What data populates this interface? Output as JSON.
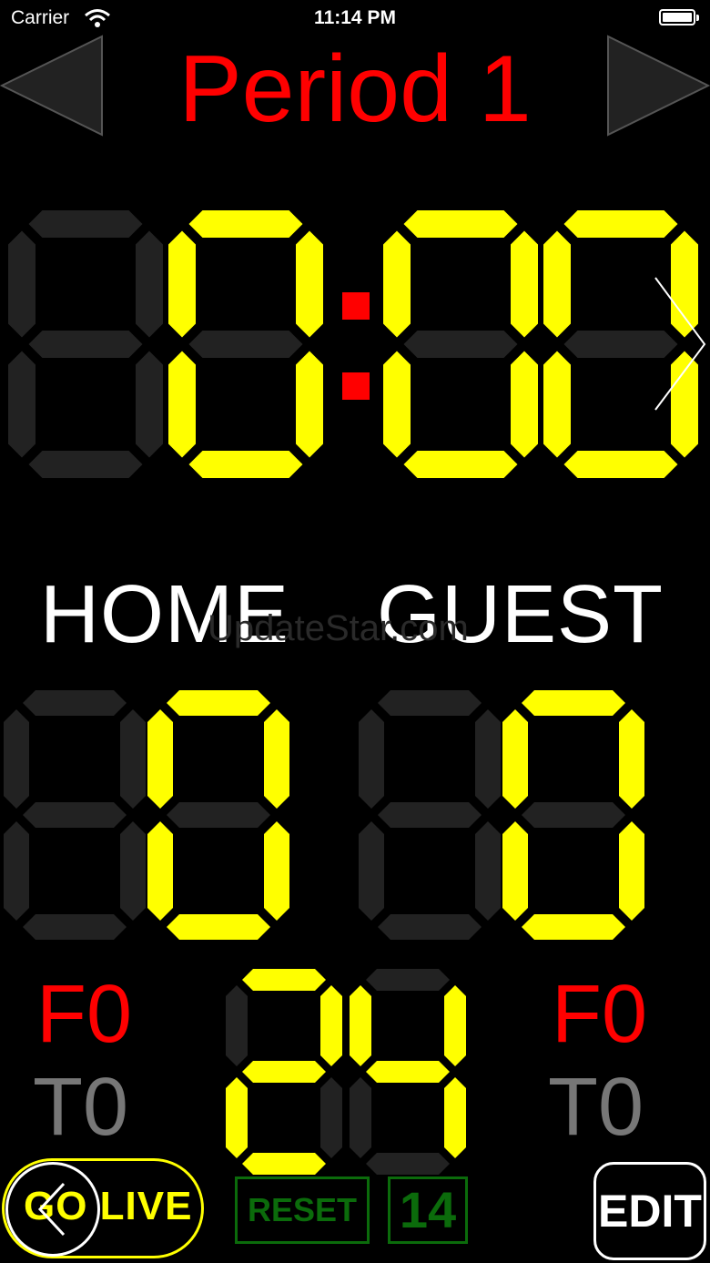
{
  "status_bar": {
    "carrier": "Carrier",
    "time": "11:14 PM",
    "wifi_icon": "wifi-icon",
    "battery_icon": "battery-icon"
  },
  "period": {
    "label": "Period 1"
  },
  "game_clock": {
    "digits": [
      " ",
      "0",
      "0",
      "0"
    ],
    "separator": ":"
  },
  "teams": {
    "home": {
      "label": "HOME",
      "score_digits": [
        " ",
        "0"
      ],
      "fouls": "F0",
      "timeouts": "T0"
    },
    "guest": {
      "label": "GUEST",
      "score_digits": [
        " ",
        "0"
      ],
      "fouls": "F0",
      "timeouts": "T0"
    }
  },
  "shot_clock": {
    "digits": [
      "2",
      "4"
    ]
  },
  "watermark": "UpdateStar.com",
  "controls": {
    "go_live_label": "GO LIVE",
    "reset_label": "RESET",
    "preset_label": "14",
    "edit_label": "EDIT"
  },
  "colors": {
    "digit_on": "#ffff00",
    "digit_off": "#222222",
    "period": "#ff0000",
    "fouls": "#ff0000",
    "timeouts": "#777777",
    "reset": "#0b6b0b"
  }
}
